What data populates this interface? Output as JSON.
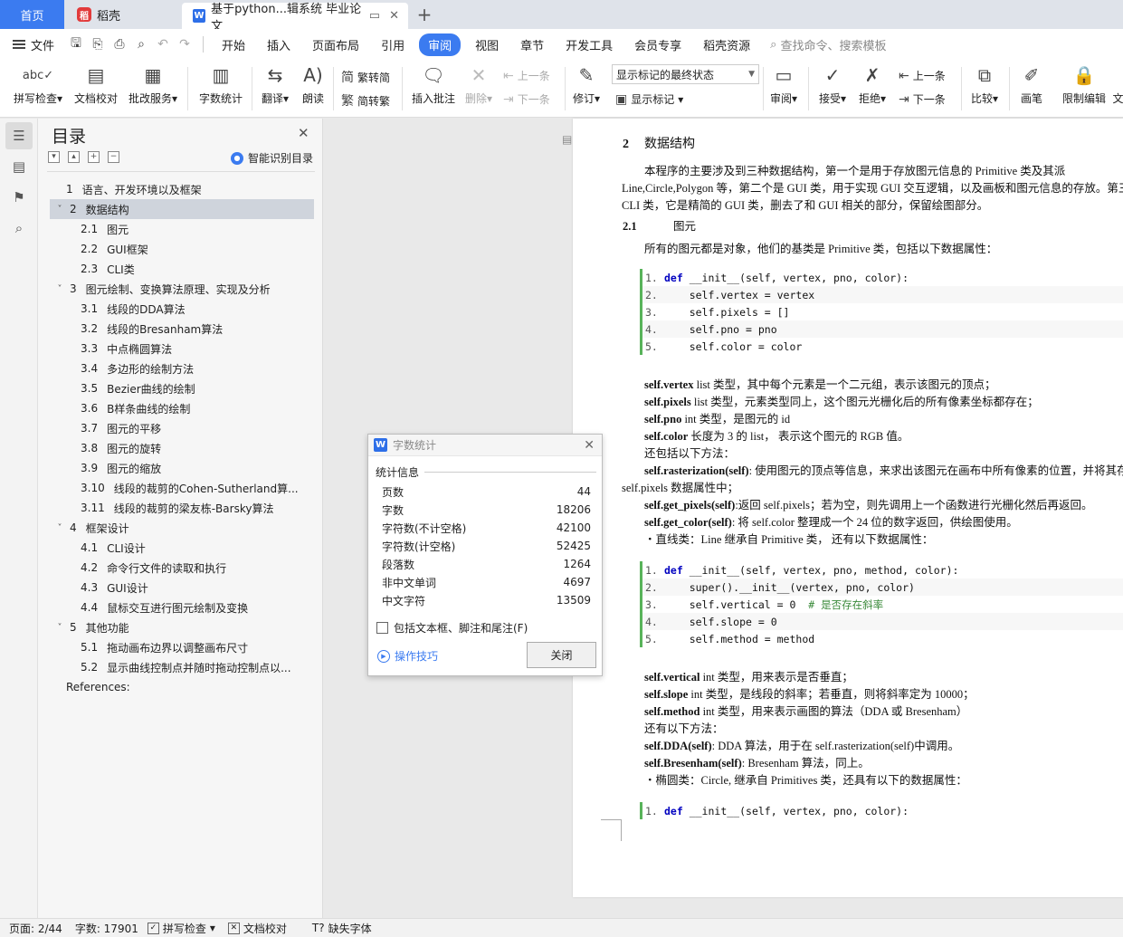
{
  "tabs": {
    "home": "首页",
    "daoke": "稻壳",
    "doc": "基于python...辑系统 毕业论文",
    "add": "+"
  },
  "menu": {
    "file": "文件",
    "items": [
      "开始",
      "插入",
      "页面布局",
      "引用",
      "审阅",
      "视图",
      "章节",
      "开发工具",
      "会员专享",
      "稻壳资源"
    ],
    "active": "审阅",
    "search": "查找命令、搜索模板"
  },
  "ribbon": {
    "spell": "拼写检查",
    "proof": "文档校对",
    "batch": "批改服务",
    "wordcount": "字数统计",
    "translate": "翻译",
    "read": "朗读",
    "to_trad": "繁转简",
    "to_simp": "简转繁",
    "insert_comment": "插入批注",
    "delete": "删除",
    "prev": "上一条",
    "next": "下一条",
    "revise": "修订",
    "show_state": "显示标记的最终状态",
    "show_mark": "显示标记",
    "review": "审阅",
    "accept": "接受",
    "reject": "拒绝",
    "prev2": "上一条",
    "next2": "下一条",
    "compare": "比较",
    "pen": "画笔",
    "restrict": "限制编辑",
    "more": "文"
  },
  "toc": {
    "title": "目录",
    "smart": "智能识别目录",
    "items": [
      {
        "num": "1",
        "text": "语言、开发环境以及框架",
        "level": 1,
        "arrow": ""
      },
      {
        "num": "2",
        "text": "数据结构",
        "level": 1,
        "arrow": "˅",
        "selected": true
      },
      {
        "num": "2.1",
        "text": "图元",
        "level": 2
      },
      {
        "num": "2.2",
        "text": "GUI框架",
        "level": 2
      },
      {
        "num": "2.3",
        "text": "CLI类",
        "level": 2
      },
      {
        "num": "3",
        "text": "图元绘制、变换算法原理、实现及分析",
        "level": 1,
        "arrow": "˅"
      },
      {
        "num": "3.1",
        "text": "线段的DDA算法",
        "level": 2
      },
      {
        "num": "3.2",
        "text": "线段的Bresanham算法",
        "level": 2
      },
      {
        "num": "3.3",
        "text": "中点椭圆算法",
        "level": 2
      },
      {
        "num": "3.4",
        "text": "多边形的绘制方法",
        "level": 2
      },
      {
        "num": "3.5",
        "text": "Bezier曲线的绘制",
        "level": 2
      },
      {
        "num": "3.6",
        "text": "B样条曲线的绘制",
        "level": 2
      },
      {
        "num": "3.7",
        "text": "图元的平移",
        "level": 2
      },
      {
        "num": "3.8",
        "text": "图元的旋转",
        "level": 2
      },
      {
        "num": "3.9",
        "text": "图元的缩放",
        "level": 2
      },
      {
        "num": "3.10",
        "text": "线段的裁剪的Cohen-Sutherland算...",
        "level": 2
      },
      {
        "num": "3.11",
        "text": "线段的裁剪的梁友栋-Barsky算法",
        "level": 2
      },
      {
        "num": "4",
        "text": "框架设计",
        "level": 1,
        "arrow": "˅"
      },
      {
        "num": "4.1",
        "text": "CLI设计",
        "level": 2
      },
      {
        "num": "4.2",
        "text": "命令行文件的读取和执行",
        "level": 2
      },
      {
        "num": "4.3",
        "text": "GUI设计",
        "level": 2
      },
      {
        "num": "4.4",
        "text": "鼠标交互进行图元绘制及变换",
        "level": 2
      },
      {
        "num": "5",
        "text": "其他功能",
        "level": 1,
        "arrow": "˅"
      },
      {
        "num": "5.1",
        "text": "拖动画布边界以调整画布尺寸",
        "level": 2
      },
      {
        "num": "5.2",
        "text": "显示曲线控制点并随时拖动控制点以...",
        "level": 2
      },
      {
        "num": "",
        "text": "References:",
        "level": 1,
        "arrow": ""
      }
    ]
  },
  "document": {
    "h2_num": "2",
    "h2_text": "数据结构",
    "p1a": "本程序的主要涉及到三种数据结构，第一个是用于存放图元信息的 Primitive 类及其派",
    "p1b": "Line,Circle,Polygon 等，第二个是 GUI 类，用于实现 GUI 交互逻辑，以及画板和图元信息的存放。第三",
    "p1c": "CLI 类，它是精简的 GUI 类，删去了和 GUI 相关的部分，保留绘图部分。",
    "h3_num": "2.1",
    "h3_text": "图元",
    "p2": "所有的图元都是对象，他们的基类是 Primitive 类，包括以下数据属性：",
    "code1": [
      {
        "n": "1.",
        "pre": "",
        "kw": "def",
        "rest": " __init__(self, vertex, pno, color):",
        "cm": ""
      },
      {
        "n": "2.",
        "pre": "    ",
        "kw": "",
        "rest": "self.vertex = vertex",
        "cm": ""
      },
      {
        "n": "3.",
        "pre": "    ",
        "kw": "",
        "rest": "self.pixels = []",
        "cm": ""
      },
      {
        "n": "4.",
        "pre": "    ",
        "kw": "",
        "rest": "self.pno = pno",
        "cm": ""
      },
      {
        "n": "5.",
        "pre": "    ",
        "kw": "",
        "rest": "self.color = color",
        "cm": ""
      }
    ],
    "attrs1": [
      {
        "b": "self.vertex",
        "t": " list 类型，其中每个元素是一个二元组，表示该图元的顶点；"
      },
      {
        "b": "self.pixels",
        "t": " list 类型，元素类型同上，这个图元光栅化后的所有像素坐标都存在；"
      },
      {
        "b": "self.pno",
        "t": " int 类型，是图元的 id"
      },
      {
        "b": "self.color",
        "t": " 长度为 3 的 list，  表示这个图元的 RGB 值。"
      },
      {
        "b": "",
        "t": "还包括以下方法："
      },
      {
        "b": "self.rasterization(self)",
        "t": ": 使用图元的顶点等信息，来求出该图元在画布中所有像素的位置，并将其存"
      }
    ],
    "wrap1": "self.pixels 数据属性中；",
    "attrs2": [
      {
        "b": "self.get_pixels(self)",
        "t": ":返回 self.pixels；若为空，则先调用上一个函数进行光栅化然后再返回。"
      },
      {
        "b": "self.get_color(self)",
        "t": ": 将 self.color 整理成一个 24 位的数字返回，供绘图使用。"
      },
      {
        "b": "",
        "t": "・直线类：Line 继承自 Primitive 类，  还有以下数据属性："
      }
    ],
    "code2": [
      {
        "n": "1.",
        "pre": "",
        "kw": "def",
        "rest": " __init__(self, vertex, pno, method, color):",
        "cm": ""
      },
      {
        "n": "2.",
        "pre": "    ",
        "kw": "",
        "rest": "super().__init__(vertex, pno, color)",
        "cm": ""
      },
      {
        "n": "3.",
        "pre": "    ",
        "kw": "",
        "rest": "self.vertical = 0  ",
        "cm": "# 是否存在斜率"
      },
      {
        "n": "4.",
        "pre": "    ",
        "kw": "",
        "rest": "self.slope = 0",
        "cm": ""
      },
      {
        "n": "5.",
        "pre": "    ",
        "kw": "",
        "rest": "self.method = method",
        "cm": ""
      }
    ],
    "attrs3": [
      {
        "b": "self.vertical",
        "t": " int 类型，用来表示是否垂直；"
      },
      {
        "b": "self.slope",
        "t": " int 类型，是线段的斜率；若垂直，则将斜率定为 10000；"
      },
      {
        "b": "self.method",
        "t": " int 类型，用来表示画图的算法（DDA 或 Bresenham）"
      },
      {
        "b": "",
        "t": "还有以下方法："
      },
      {
        "b": "self.DDA(self)",
        "t": ": DDA 算法，用于在 self.rasterization(self)中调用。"
      },
      {
        "b": "self.Bresenham(self)",
        "t": ": Bresenham 算法，同上。"
      },
      {
        "b": "",
        "t": "・椭圆类：Circle, 继承自 Primitives 类，还具有以下的数据属性："
      }
    ],
    "code3": [
      {
        "n": "1.",
        "pre": "",
        "kw": "def",
        "rest": " __init__(self, vertex, pno, color):",
        "cm": ""
      }
    ]
  },
  "dialog": {
    "title": "字数统计",
    "section": "统计信息",
    "rows": [
      {
        "label": "页数",
        "value": "44"
      },
      {
        "label": "字数",
        "value": "18206"
      },
      {
        "label": "字符数(不计空格)",
        "value": "42100"
      },
      {
        "label": "字符数(计空格)",
        "value": "52425"
      },
      {
        "label": "段落数",
        "value": "1264"
      },
      {
        "label": "非中文单词",
        "value": "4697"
      },
      {
        "label": "中文字符",
        "value": "13509"
      }
    ],
    "checkbox": "包括文本框、脚注和尾注(F)",
    "tips": "操作技巧",
    "close": "关闭"
  },
  "status": {
    "page": "页面: 2/44",
    "words": "字数: 17901",
    "spell": "拼写检查",
    "proof": "文档校对",
    "font": "缺失字体"
  },
  "colors": {
    "accent": "#3b7bf0",
    "code_bar": "#58b35a"
  }
}
